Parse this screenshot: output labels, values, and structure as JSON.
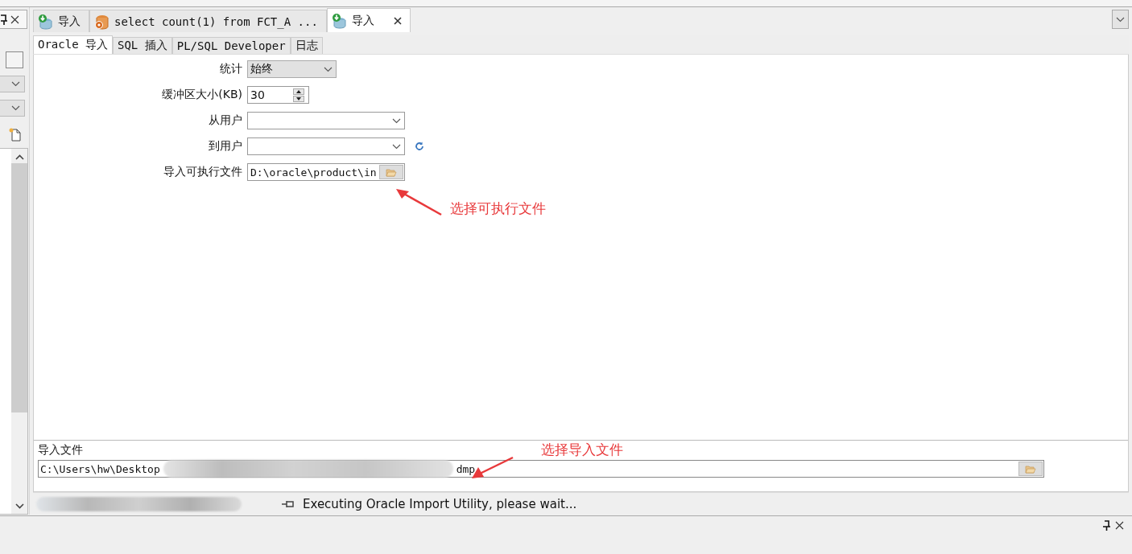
{
  "tabs": [
    {
      "label": "导入",
      "kind": "import",
      "selected": false
    },
    {
      "label": "select count(1) from FCT_A ...",
      "kind": "query",
      "selected": false
    },
    {
      "label": "导入",
      "kind": "import",
      "selected": true
    }
  ],
  "subtabs": [
    {
      "label": "Oracle 导入",
      "selected": true
    },
    {
      "label": "SQL 插入",
      "selected": false
    },
    {
      "label": "PL/SQL Developer",
      "selected": false
    },
    {
      "label": "日志",
      "selected": false
    }
  ],
  "form": [
    {
      "label": "统计",
      "kind": "select",
      "value": "始终"
    },
    {
      "label": "缓冲区大小(KB)",
      "kind": "spinner",
      "value": "30"
    },
    {
      "label": "从用户",
      "kind": "select"
    },
    {
      "label": "到用户",
      "kind": "select-refresh"
    },
    {
      "label": "导入可执行文件",
      "kind": "file",
      "value": "D:\\oracle\\product\\in"
    }
  ],
  "annotations": [
    {
      "text": "选择可执行文件"
    },
    {
      "text": "选择导入文件"
    }
  ],
  "import_file": {
    "label": "导入文件",
    "value_start": "C:\\Users\\hw\\Desktop",
    "value_end": "dmp"
  },
  "status_bar": {
    "message": "Executing Oracle Import Utility, please wait..."
  }
}
